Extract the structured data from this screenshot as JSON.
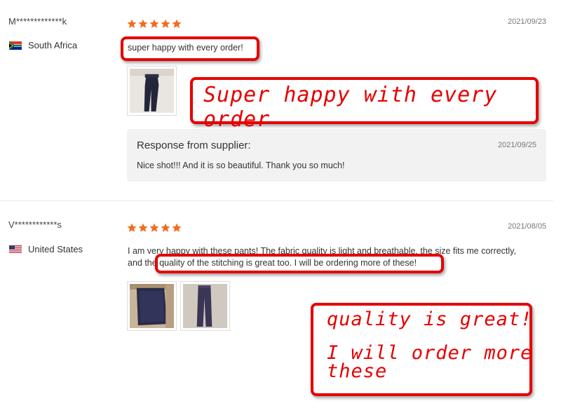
{
  "reviews": [
    {
      "reviewer": "M*************k",
      "country": "South Africa",
      "rating": 5,
      "date": "2021/09/23",
      "text": "super happy with every order!",
      "photos": [
        "jeans-photo"
      ],
      "supplier_response": {
        "title": "Response from supplier:",
        "date": "2021/09/25",
        "message": "Nice shot!!! And it is so beautiful. Thank you so much!"
      }
    },
    {
      "reviewer": "V************s",
      "country": "United States",
      "rating": 5,
      "date": "2021/08/05",
      "text_line1": "I am very happy with these pants! The fabric quality is light and breathable, the size fits me correctly,",
      "text_line2_prefix": "and the ",
      "text_line2_highlight": "quality of the stitching is great too. I will be ordering more of these!",
      "photos": [
        "pants-folded-photo",
        "pants-hanging-photo"
      ]
    }
  ],
  "annotations": {
    "note1": "Super happy with every order",
    "note2_line1": "quality is great!",
    "note2_line2": "I will order more",
    "note2_line3": "these"
  },
  "colors": {
    "star": "#f36b1c",
    "annotation_red": "#e60000"
  }
}
